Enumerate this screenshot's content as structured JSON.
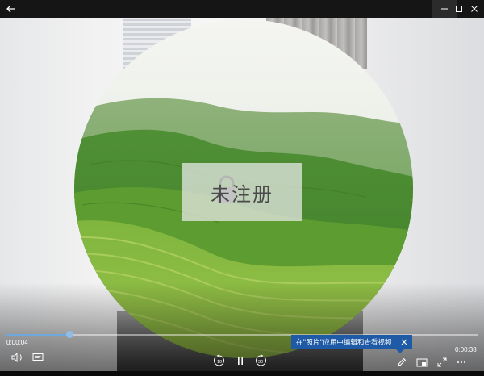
{
  "window": {
    "back_icon": "back-arrow-icon",
    "minimize_icon": "minimize-icon",
    "maximize_icon": "maximize-icon",
    "close_icon": "close-icon"
  },
  "video": {
    "watermark_text": "未注册",
    "elapsed": "0:00:04",
    "duration": "0:00:38",
    "progress": 0.135
  },
  "tooltip": {
    "text": "在\"照片\"应用中编辑和查看视频"
  },
  "controls": {
    "volume_icon": "volume-icon",
    "captions_icon": "captions-icon",
    "rewind_label": "10",
    "forward_label": "30",
    "pause_icon": "pause-icon",
    "edit_icon": "pencil-icon",
    "mini_view_icon": "mini-view-icon",
    "fullscreen_icon": "fullscreen-icon",
    "more_icon": "more-icon"
  },
  "colors": {
    "accent": "#1e5aa6",
    "seek_fill": "#6fa8dc"
  }
}
